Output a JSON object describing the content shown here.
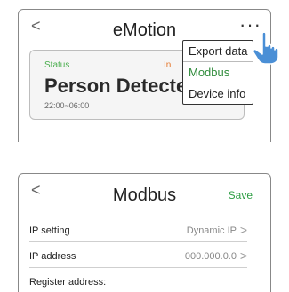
{
  "top_screen": {
    "back_glyph": "<",
    "title": "eMotion",
    "more_glyph": "···",
    "status_card": {
      "label": "Status",
      "right_label": "In",
      "value": "Person Detected",
      "schedule": "22:00~06:00"
    },
    "menu": {
      "items": [
        "Export data",
        "Modbus",
        "Device info"
      ],
      "active_index": 1
    },
    "colors": {
      "status_label": "#4caf50",
      "status_right": "#e6762a",
      "menu_active": "#2e8b3a",
      "hand": "#4a8fd6"
    },
    "pointer_icon": "tap-hand-icon"
  },
  "bottom_screen": {
    "back_glyph": "<",
    "title": "Modbus",
    "save_label": "Save",
    "rows": [
      {
        "label": "IP setting",
        "value": "Dynamic IP",
        "chevron": ">"
      },
      {
        "label": "IP address",
        "value": "000.000.0.0",
        "chevron": ">"
      }
    ],
    "register_label": "Register address:",
    "colors": {
      "save": "#2e9e44"
    }
  }
}
